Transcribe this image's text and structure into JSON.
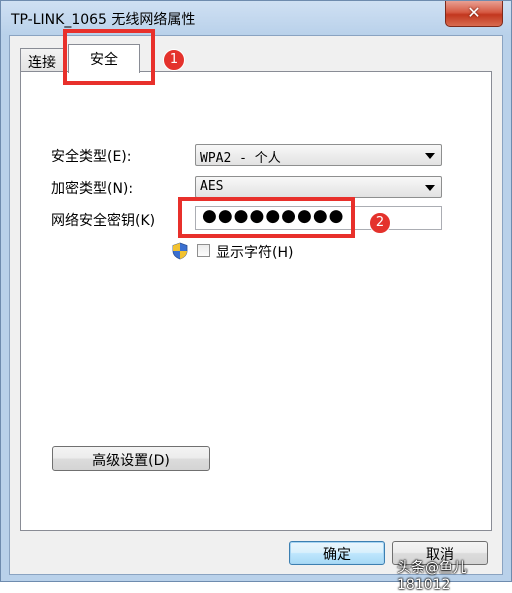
{
  "window": {
    "title": "TP-LINK_1065 无线网络属性",
    "close_glyph": "✕"
  },
  "tabs": [
    {
      "label": "连接"
    },
    {
      "label": "安全"
    }
  ],
  "security": {
    "security_type_label": "安全类型(E):",
    "security_type_value": "WPA2 - 个人",
    "encryption_type_label": "加密类型(N):",
    "encryption_type_value": "AES",
    "key_label": "网络安全密钥(K)",
    "key_value": "●●●●●●●●●",
    "show_chars_label": "显示字符(H)",
    "show_chars_checked": false
  },
  "advanced_button": "高级设置(D)",
  "buttons": {
    "ok": "确定",
    "cancel": "取消"
  },
  "annotations": {
    "marker_1": "1",
    "marker_2": "2",
    "highlight_color": "#e8302b"
  },
  "watermark": "头条@鱼儿181012"
}
